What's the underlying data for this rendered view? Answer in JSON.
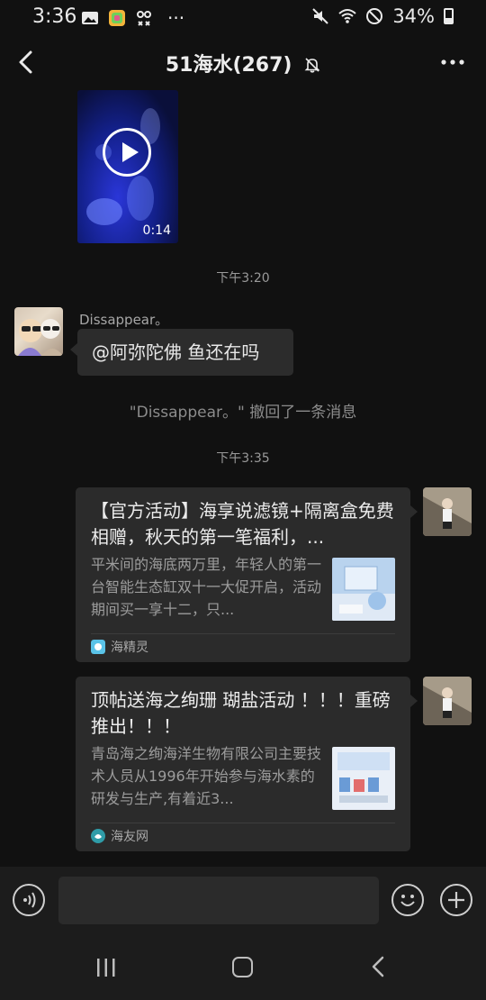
{
  "status_bar": {
    "time": "3:36",
    "dots": "···",
    "battery": "34%"
  },
  "header": {
    "title": "51海水(267)"
  },
  "messages": {
    "video": {
      "duration": "0:14"
    },
    "timestamp_1": "下午3:20",
    "sender": "Dissappear。",
    "text_message": "@阿弥陀佛  鱼还在吗",
    "system_notice": "\"Dissappear。\" 撤回了一条消息",
    "timestamp_2": "下午3:35",
    "cards": [
      {
        "title": "【官方活动】海享说滤镜+隔离盒免费相赠，秋天的第一笔福利，...",
        "description": "平米间的海底两万里，年轻人的第一台智能生态缸双十一大促开启，活动期间买一享十二，只...",
        "source": "海精灵"
      },
      {
        "title": "顶帖送海之绚珊 瑚盐活动 ！！！重磅推出！！！",
        "description": "青岛海之绚海洋生物有限公司主要技术人员从1996年开始参与海水素的研发与生产,有着近3...",
        "source": "海友网"
      }
    ]
  },
  "colors": {
    "background": "#111111",
    "bubble": "#2b2b2b",
    "text": "#e8e8e8",
    "muted": "#9c9c9c"
  }
}
